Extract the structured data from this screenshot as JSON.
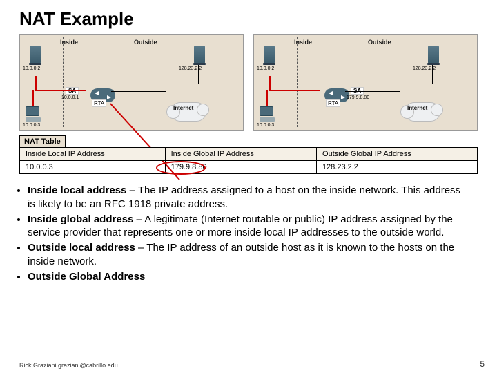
{
  "title": "NAT Example",
  "diagram": {
    "inside": "Inside",
    "outside": "Outside",
    "server_ip": "10.0.0.2",
    "pc_ip": "10.0.0.3",
    "rta": "RTA",
    "sa": "SA",
    "internet": "Internet",
    "outside_ip": "128.23.2.2",
    "sa_left": "10.0.0.1",
    "sa_right": "179.9.8.80"
  },
  "nat_table": {
    "title": "NAT Table",
    "headers": [
      "Inside Local IP Address",
      "Inside Global IP Address",
      "Outside Global IP Address"
    ],
    "row": [
      "10.0.0.3",
      "179.9.8.80",
      "128.23.2.2"
    ]
  },
  "bullets": [
    {
      "term": "Inside local address",
      "text": " – The IP address assigned to a host on the inside network. This address is likely to be an RFC 1918 private address."
    },
    {
      "term": "Inside global address",
      "text": " – A legitimate (Internet routable or public) IP address assigned by the service provider that represents one or more inside local IP addresses to the outside world."
    },
    {
      "term": "Outside local address",
      "text": " – The IP address of an outside host as it is known to the hosts on the inside network."
    },
    {
      "term": "Outside Global Address",
      "text": ""
    }
  ],
  "footer": "Rick Graziani  graziani@cabrillo.edu",
  "page": "5"
}
